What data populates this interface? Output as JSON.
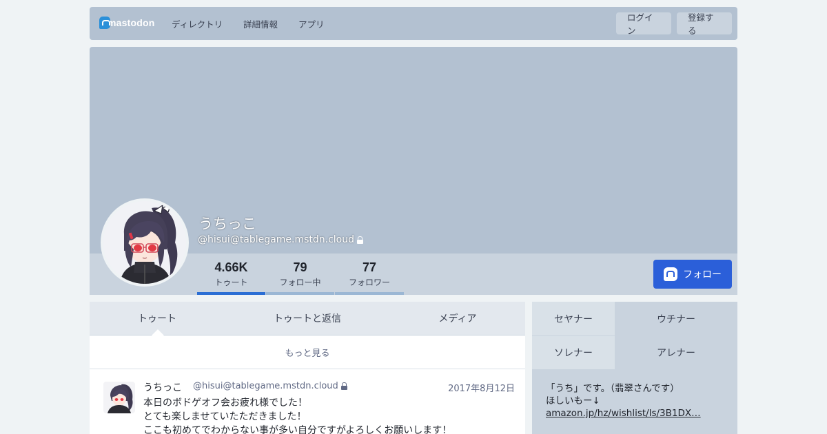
{
  "nav": {
    "logo_text": "mastodon",
    "links": [
      "ディレクトリ",
      "詳細情報",
      "アプリ"
    ],
    "login": "ログイン",
    "signup": "登録する"
  },
  "profile": {
    "display_name": "うちっこ",
    "acct": "@hisui@tablegame.mstdn.cloud",
    "locked": true,
    "follow_label": "フォロー"
  },
  "stats": [
    {
      "value": "4.66K",
      "label": "トゥート",
      "active": true
    },
    {
      "value": "79",
      "label": "フォロー中",
      "active": false
    },
    {
      "value": "77",
      "label": "フォロワー",
      "active": false
    }
  ],
  "tabs": {
    "toots": "トゥート",
    "replies": "トゥートと返信",
    "media": "メディア"
  },
  "load_more": "もっと見る",
  "status": {
    "name": "うちっこ",
    "acct": "@hisui@tablegame.mstdn.cloud",
    "time": "2017年8月12日",
    "lines": [
      "本日のボドゲオフ会お疲れ様でした！",
      "とても楽しませていたただきました！",
      "ここも初めてでわからない事が多い自分ですがよろしくお願いします！"
    ]
  },
  "fields": [
    {
      "name": "セヤナー",
      "value": "ウチナー"
    },
    {
      "name": "ソレナー",
      "value": "アレナー"
    }
  ],
  "bio": {
    "line1": "「うち」です。（翡翠さんです）",
    "line2": "ほしいもー↓",
    "link": "amazon.jp/hz/wishlist/ls/3B1DX…"
  },
  "colors": {
    "accent": "#2b5fd9",
    "header_bg": "#b3c1d1",
    "page_bg": "#eff3f5"
  }
}
